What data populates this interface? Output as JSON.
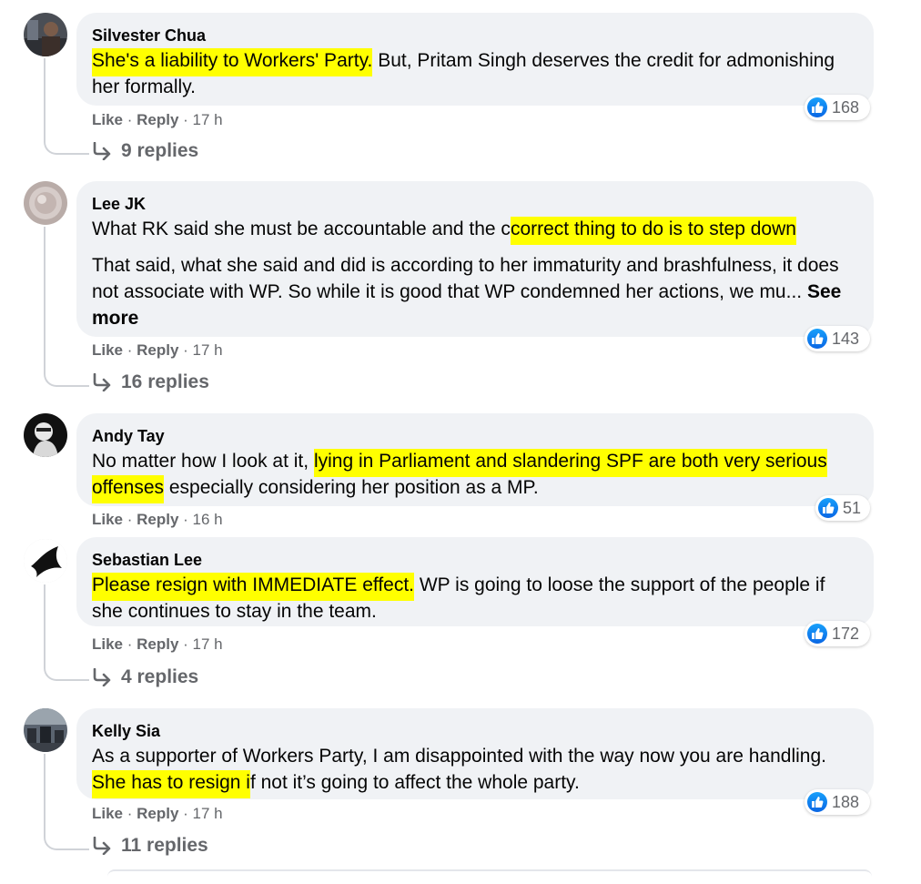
{
  "comments": [
    {
      "name": "Silvester Chua",
      "segments": [
        {
          "text": "She's a liability to Workers' Party.",
          "highlighted": true
        },
        {
          "text": " But, Pritam Singh deserves the credit for admonishing her formally.",
          "highlighted": false
        }
      ],
      "reactions": "168",
      "like": "Like",
      "reply": "Reply",
      "time": "17 h",
      "replies": "9 replies"
    },
    {
      "name": "Lee JK",
      "paragraph1": [
        {
          "text": "What RK said she must be accountable and the c",
          "highlighted": false
        },
        {
          "text": "correct thing to do is to step down",
          "highlighted": true
        }
      ],
      "paragraph2": "That said, what she said and did is according to her immaturity and brashfulness, it does not associate with WP. So while it is good that WP condemned her actions, we mu...",
      "see_more": "See more",
      "reactions": "143",
      "like": "Like",
      "reply": "Reply",
      "time": "17 h",
      "replies": "16 replies"
    },
    {
      "name": "Andy Tay",
      "segments": [
        {
          "text": "No matter how I look at it, ",
          "highlighted": false
        },
        {
          "text": "lying in Parliament and slandering SPF are both very serious offenses",
          "highlighted": true
        },
        {
          "text": " especially considering her position as a MP.",
          "highlighted": false
        }
      ],
      "reactions": "51",
      "like": "Like",
      "reply": "Reply",
      "time": "16 h"
    },
    {
      "name": "Sebastian Lee",
      "segments": [
        {
          "text": "Please resign with IMMEDIATE effect.",
          "highlighted": true
        },
        {
          "text": " WP is going to loose the support of the people if she continues to stay in the team.",
          "highlighted": false
        }
      ],
      "reactions": "172",
      "like": "Like",
      "reply": "Reply",
      "time": "17 h",
      "replies": "4 replies"
    },
    {
      "name": "Kelly Sia",
      "segments": [
        {
          "text": "As a supporter of Workers Party, I am disappointed with the way now you are handling. ",
          "highlighted": false
        },
        {
          "text": "She has to resign i",
          "highlighted": true
        },
        {
          "text": "f not it’s going to affect the whole party.",
          "highlighted": false
        }
      ],
      "reactions": "188",
      "like": "Like",
      "reply": "Reply",
      "time": "17 h",
      "replies": "11 replies"
    }
  ],
  "colors": {
    "bubble": "#f0f2f5",
    "highlight": "#ffff00",
    "secondary_text": "#65676b",
    "like_blue": "#0a66e4"
  },
  "icons": {
    "reaction": "like-thumb-icon",
    "replies": "reply-arrow-icon"
  }
}
